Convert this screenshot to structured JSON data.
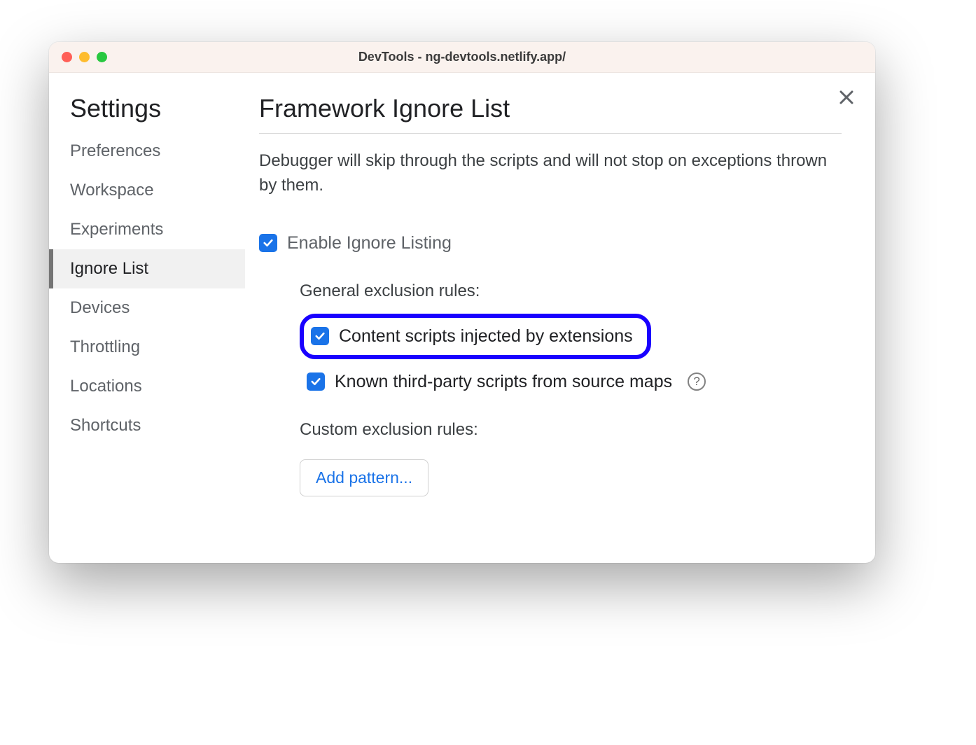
{
  "window": {
    "title": "DevTools - ng-devtools.netlify.app/"
  },
  "sidebar": {
    "title": "Settings",
    "items": [
      {
        "label": "Preferences",
        "active": false
      },
      {
        "label": "Workspace",
        "active": false
      },
      {
        "label": "Experiments",
        "active": false
      },
      {
        "label": "Ignore List",
        "active": true
      },
      {
        "label": "Devices",
        "active": false
      },
      {
        "label": "Throttling",
        "active": false
      },
      {
        "label": "Locations",
        "active": false
      },
      {
        "label": "Shortcuts",
        "active": false
      }
    ]
  },
  "main": {
    "title": "Framework Ignore List",
    "description": "Debugger will skip through the scripts and will not stop on exceptions thrown by them.",
    "enable_label": "Enable Ignore Listing",
    "general_heading": "General exclusion rules:",
    "rule_content_scripts": "Content scripts injected by extensions",
    "rule_third_party": "Known third-party scripts from source maps",
    "custom_heading": "Custom exclusion rules:",
    "add_pattern_label": "Add pattern..."
  },
  "checkboxes": {
    "enable": true,
    "content_scripts": true,
    "third_party": true
  },
  "highlight": {
    "color": "#1900ff"
  }
}
